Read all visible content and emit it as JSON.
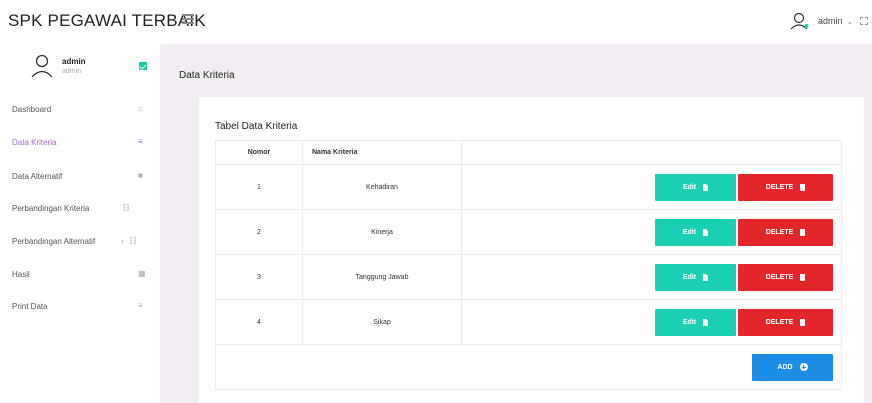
{
  "app": {
    "title": "SPK PEGAWAI TERBAIK"
  },
  "header": {
    "user_label": "admin",
    "caret": "⌄"
  },
  "sidebar": {
    "profile": {
      "name": "admin",
      "role": "admin"
    },
    "items": [
      {
        "label": "Dashboard",
        "icon": "home-icon",
        "glyph": "⌂",
        "active": false
      },
      {
        "label": "Data Kriteria",
        "icon": "menu-icon",
        "glyph": "≡",
        "active": true
      },
      {
        "label": "Data Alternatif",
        "icon": "database-icon",
        "glyph": "■",
        "active": false
      },
      {
        "label": "Perbandingan Kriteria",
        "icon": "compare-icon",
        "glyph": "⁅⁆",
        "active": false
      },
      {
        "label": "Perbandingan Alternatif",
        "icon": "compare-icon",
        "glyph": "⁅⁆",
        "arrow": "‹",
        "active": false
      },
      {
        "label": "Hasil",
        "icon": "table-icon",
        "glyph": "▦",
        "active": false
      },
      {
        "label": "Print Data",
        "icon": "menu-icon",
        "glyph": "≡",
        "active": false
      }
    ]
  },
  "main": {
    "page_title": "Data Kriteria",
    "card_title": "Tabel Data Kriteria",
    "table": {
      "headers": [
        "Nomor",
        "Nama Kriteria",
        ""
      ],
      "rows": [
        {
          "no": "1",
          "name": "Kehadiran"
        },
        {
          "no": "2",
          "name": "Kinerja"
        },
        {
          "no": "3",
          "name": "Tanggung Jawab"
        },
        {
          "no": "4",
          "name": "Sikap"
        }
      ],
      "edit_label": "Edit",
      "delete_label": "DELETE",
      "add_label": "ADD"
    }
  },
  "colors": {
    "accent": "#a36ac7",
    "edit": "#1bcfb4",
    "delete": "#e3262a",
    "add": "#1d8ee6",
    "background": "#f2edf3"
  }
}
